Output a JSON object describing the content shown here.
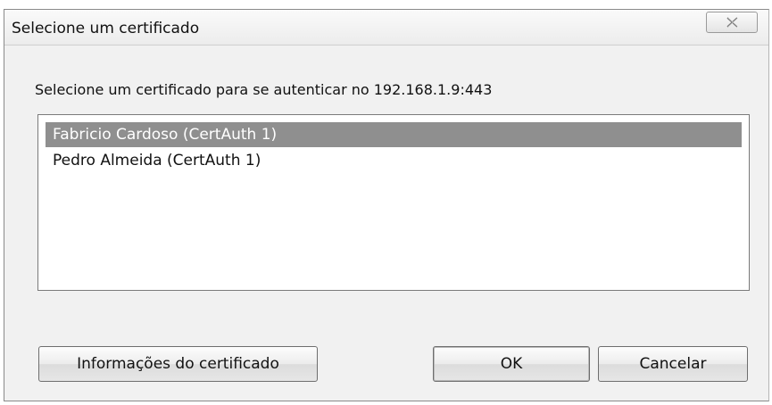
{
  "window": {
    "title": "Selecione um certificado",
    "close_icon": "close-x-icon"
  },
  "prompt": "Selecione um certificado para se autenticar no 192.168.1.9:443",
  "certificates": [
    {
      "label": "Fabricio Cardoso (CertAuth 1)",
      "selected": true
    },
    {
      "label": "Pedro Almeida (CertAuth 1)",
      "selected": false
    }
  ],
  "buttons": {
    "info_label": "Informações do certificado",
    "ok_label": "OK",
    "cancel_label": "Cancelar"
  },
  "colors": {
    "selection": "#8f8f8f",
    "dialog_bg": "#f1f1f1"
  }
}
